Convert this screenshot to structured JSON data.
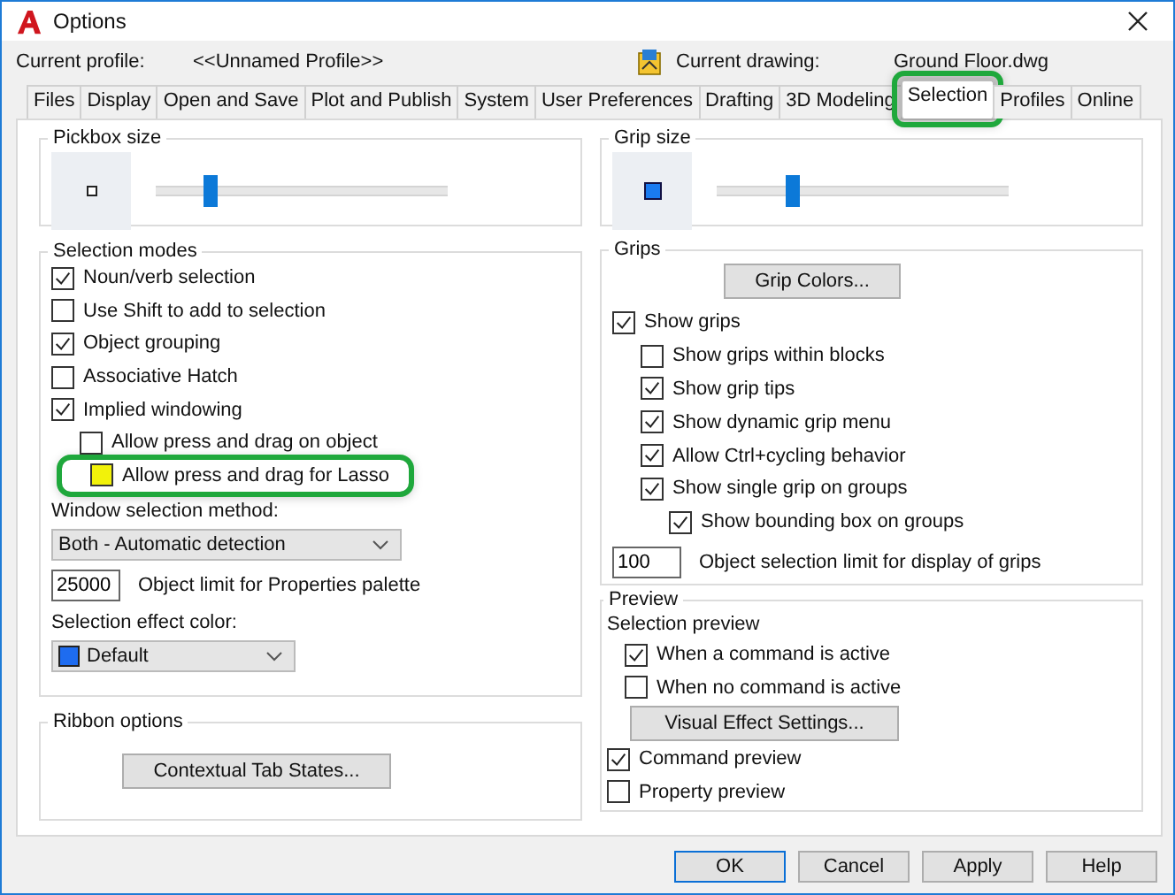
{
  "window": {
    "title": "Options"
  },
  "profile": {
    "label": "Current profile:",
    "value": "<<Unnamed Profile>>"
  },
  "drawing": {
    "label": "Current drawing:",
    "value": "Ground Floor.dwg"
  },
  "tabs": [
    {
      "label": "Files",
      "selected": false,
      "highlighted": false
    },
    {
      "label": "Display",
      "selected": false,
      "highlighted": false
    },
    {
      "label": "Open and Save",
      "selected": false,
      "highlighted": false
    },
    {
      "label": "Plot and Publish",
      "selected": false,
      "highlighted": false
    },
    {
      "label": "System",
      "selected": false,
      "highlighted": false
    },
    {
      "label": "User Preferences",
      "selected": false,
      "highlighted": false
    },
    {
      "label": "Drafting",
      "selected": false,
      "highlighted": false
    },
    {
      "label": "3D Modeling",
      "selected": false,
      "highlighted": false
    },
    {
      "label": "Selection",
      "selected": true,
      "highlighted": true
    },
    {
      "label": "Profiles",
      "selected": false,
      "highlighted": false
    },
    {
      "label": "Online",
      "selected": false,
      "highlighted": false
    }
  ],
  "pickbox": {
    "title": "Pickbox size",
    "level": 0.17
  },
  "selection_modes": {
    "title": "Selection modes",
    "options": [
      {
        "label": "Noun/verb selection",
        "checked": true
      },
      {
        "label": "Use Shift to add to selection",
        "checked": false
      },
      {
        "label": "Object grouping",
        "checked": true
      },
      {
        "label": "Associative Hatch",
        "checked": false
      },
      {
        "label": "Implied windowing",
        "checked": true,
        "children": [
          {
            "label": "Allow press and drag on object",
            "checked": false
          },
          {
            "label": "Allow press and drag for Lasso",
            "checked": false,
            "highlighted": true
          }
        ]
      }
    ],
    "window_method": {
      "label": "Window selection method:",
      "value": "Both - Automatic detection"
    },
    "object_limit": {
      "value": "25000",
      "label": "Object limit for Properties palette"
    },
    "effect_color": {
      "label": "Selection effect color:",
      "value": "Default",
      "color": "#1e6cf0"
    }
  },
  "ribbon": {
    "title": "Ribbon options",
    "button": "Contextual Tab States..."
  },
  "grip_size": {
    "title": "Grip size",
    "level": 0.24
  },
  "grips": {
    "title": "Grips",
    "button": "Grip Colors...",
    "options": [
      {
        "label": "Show grips",
        "checked": true,
        "children": [
          {
            "label": "Show grips within blocks",
            "checked": false
          },
          {
            "label": "Show grip tips",
            "checked": true
          },
          {
            "label": "Show dynamic grip menu",
            "checked": true
          },
          {
            "label": "Allow Ctrl+cycling behavior",
            "checked": true
          },
          {
            "label": "Show single grip on groups",
            "checked": true,
            "children": [
              {
                "label": "Show bounding box on groups",
                "checked": true
              }
            ]
          }
        ]
      }
    ],
    "limit": {
      "value": "100",
      "label": "Object selection limit for display of grips"
    }
  },
  "preview": {
    "title": "Preview",
    "items": [
      {
        "kind": "label",
        "label": "Selection preview",
        "children": [
          {
            "kind": "checkbox",
            "label": "When a command is active",
            "checked": true
          },
          {
            "kind": "checkbox",
            "label": "When no command is active",
            "checked": false
          },
          {
            "kind": "button",
            "label": "Visual Effect Settings..."
          }
        ]
      },
      {
        "kind": "checkbox",
        "label": "Command preview",
        "checked": true
      },
      {
        "kind": "checkbox",
        "label": "Property preview",
        "checked": false
      }
    ]
  },
  "buttons": [
    {
      "label": "OK",
      "default": true
    },
    {
      "label": "Cancel",
      "default": false
    },
    {
      "label": "Apply",
      "default": false
    },
    {
      "label": "Help",
      "default": false
    }
  ]
}
